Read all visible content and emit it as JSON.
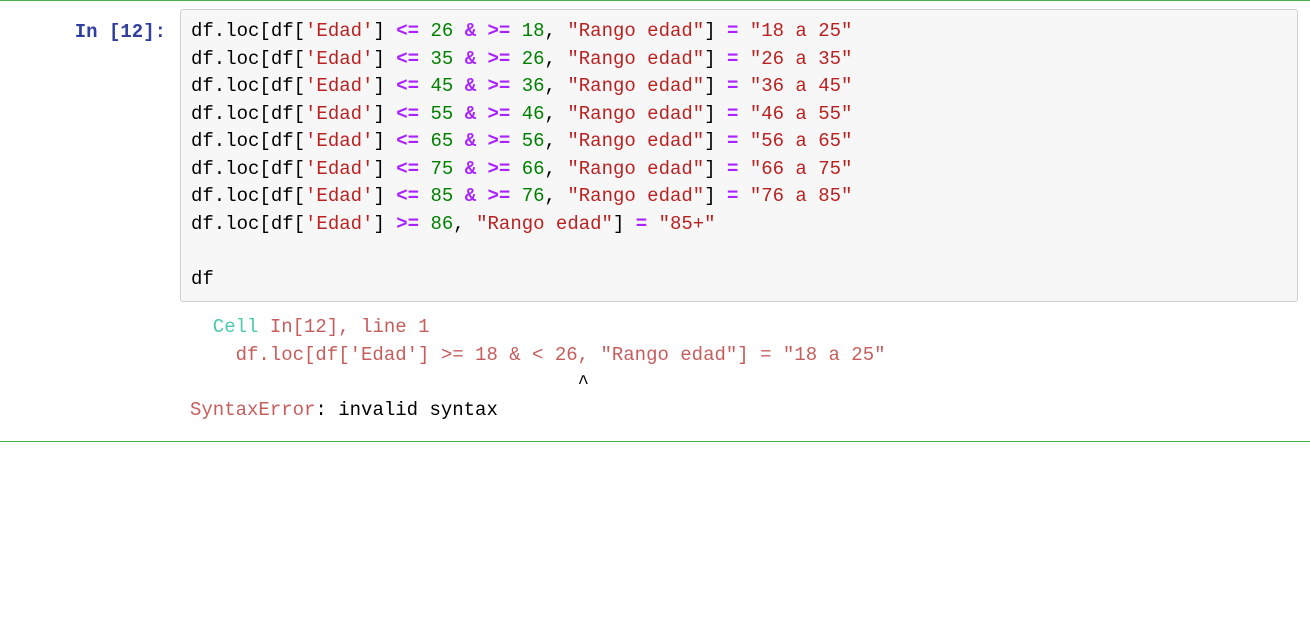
{
  "prompt": {
    "label": "In [12]:"
  },
  "tokens": {
    "df_loc_open": "df.loc[df[",
    "edad_lit": "'Edad'",
    "close_bracket_sp": "] ",
    "op_le": "<=",
    "op_ge": ">=",
    "op_amp": "&",
    "op_eq": "=",
    "sp": " ",
    "comma_sp": ", ",
    "rango_lit": "\"Rango edad\"",
    "close_sq_sp": "] ",
    "num_26": "26",
    "num_18": "18",
    "num_35": "35",
    "num_45": "45",
    "num_36": "36",
    "num_55": "55",
    "num_46": "46",
    "num_65": "65",
    "num_56": "56",
    "num_75": "75",
    "num_66": "66",
    "num_85": "85",
    "num_76": "76",
    "num_86": "86",
    "str_18_25": "\"18 a 25\"",
    "str_26_35": "\"26 a 35\"",
    "str_36_45": "\"36 a 45\"",
    "str_46_55": "\"46 a 55\"",
    "str_56_65": "\"56 a 65\"",
    "str_66_75": "\"66 a 75\"",
    "str_76_85": "\"76 a 85\"",
    "str_85plus": "\"85+\"",
    "df_alone": "df"
  },
  "output": {
    "cell_word": "  Cell ",
    "in_ref": "In[12]",
    "line_ref": ", line 1",
    "err_code": "    df.loc[df['Edad'] >= 18 & < 26, \"Rango edad\"] = \"18 a 25\"",
    "caret": "                                  ^",
    "err_label": "SyntaxError",
    "err_colon": ": ",
    "err_msg": "invalid syntax"
  }
}
